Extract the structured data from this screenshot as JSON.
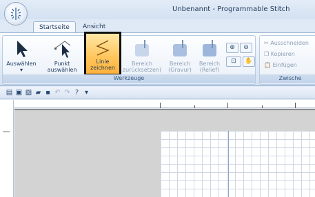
{
  "window": {
    "title": "Unbenannt - Programmable Stitch"
  },
  "tabs": [
    {
      "label": "Startseite"
    },
    {
      "label": "Ansicht"
    }
  ],
  "ribbon": {
    "werkzeuge_group": {
      "label": "Werkzeuge",
      "auswaehlen_label": "Auswählen",
      "punkt_label_1": "Punkt",
      "punkt_label_2": "auswählen",
      "linie_label_1": "Linie",
      "linie_label_2": "zeichnen",
      "bereich_zurueck_1": "Bereich",
      "bereich_zurueck_2": "zurücksetzen)",
      "bereich_gravur_1": "Bereich",
      "bereich_gravur_2": "(Gravur)",
      "bereich_relief_1": "Bereich",
      "bereich_relief_2": "(Relief)"
    },
    "zwischenablage_group": {
      "label": "Zwische",
      "ausschneiden": "Ausschneiden",
      "kopieren": "Kopieren",
      "einfuegen": "Einfügen"
    }
  },
  "colors": {
    "accent_selected": "#ffc55a",
    "ribbon_bg": "#dfe9f5",
    "page_grid": "#d0d7e3"
  }
}
